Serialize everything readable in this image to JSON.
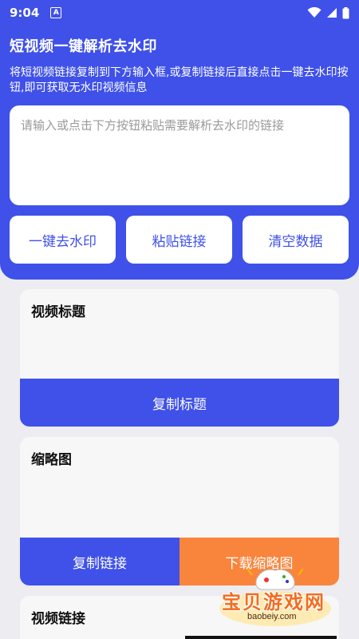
{
  "status_bar": {
    "time": "9:04",
    "app_icon_letter": "A",
    "icons": [
      "wifi-icon",
      "cellular-signal-icon",
      "battery-icon"
    ]
  },
  "header": {
    "title": "短视频一键解析去水印",
    "description": "将短视频链接复制到下方输入框,或复制链接后直接点击一键去水印按钮,即可获取无水印视频信息"
  },
  "input": {
    "value": "",
    "placeholder": "请输入或点击下方按钮粘贴需要解析去水印的链接"
  },
  "actions": {
    "remove_watermark": "一键去水印",
    "paste_link": "粘贴链接",
    "clear_data": "清空数据"
  },
  "cards": {
    "title_card": {
      "label": "视频标题",
      "button": "复制标题"
    },
    "thumbnail_card": {
      "label": "缩略图",
      "copy_button": "复制链接",
      "download_button": "下载缩略图"
    },
    "link_card": {
      "label": "视频链接"
    }
  },
  "watermark": {
    "text": "宝贝游戏网",
    "url": "baobeiy.com"
  },
  "colors": {
    "primary": "#3f51e8",
    "accent": "#f9853d",
    "background": "#ececf1",
    "card": "#f7f7f7"
  }
}
